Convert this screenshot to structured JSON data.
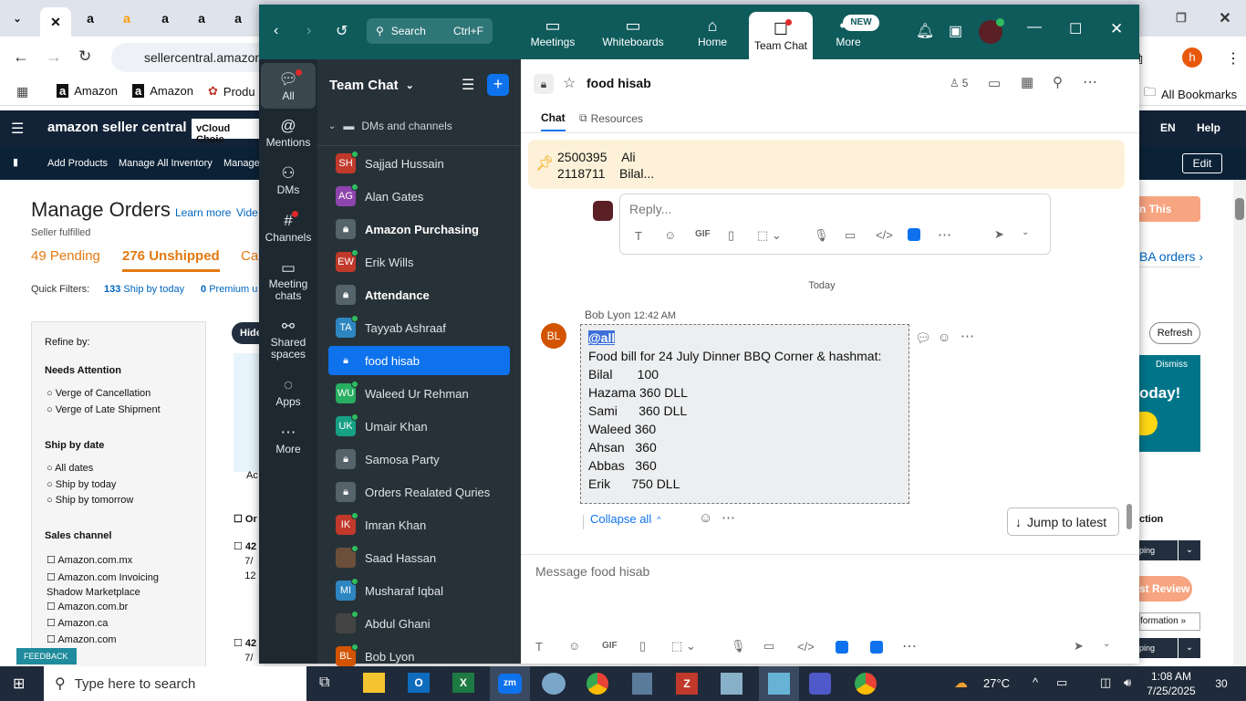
{
  "browser": {
    "url": "sellercentral.amazon",
    "bookmarks": [
      "Amazon",
      "Amazon",
      "Produ"
    ],
    "all_bookmarks": "All Bookmarks",
    "profile_initial": "h"
  },
  "amazon": {
    "logo": "amazon seller central",
    "vcloud": "vCloud Choic",
    "lang": "EN",
    "help": "Help",
    "nav": [
      "Add Products",
      "Manage All Inventory",
      "Manage"
    ],
    "edit": "Edit",
    "page_title": "Manage Orders",
    "learn_more": "Learn more",
    "video": "Vide",
    "seller_fulfilled": "Seller fulfilled",
    "pending": "49 Pending",
    "unshipped_count": "276",
    "unshipped_label": "Unshipped",
    "canceled_partial": "Ca",
    "quick_filters": "Quick Filters:",
    "qf_ship_today_count": "133",
    "qf_ship_today": "Ship by today",
    "qf_premium_count": "0",
    "qf_premium": "Premium u",
    "refine": "Refine by:",
    "needs_attention": "Needs Attention",
    "attention_opts": [
      "Verge of Cancellation",
      "Verge of Late Shipment"
    ],
    "ship_by_date": "Ship by date",
    "ship_opts": [
      "All dates",
      "Ship by today",
      "Ship by tomorrow"
    ],
    "sales_channel": "Sales channel",
    "channels": [
      "Amazon.com.mx",
      "Amazon.com Invoicing Shadow Marketplace",
      "Amazon.com.br",
      "Amazon.ca",
      "Amazon.com"
    ],
    "hide": "Hide",
    "ac": "Ac",
    "order_col": "Or",
    "row1": "42",
    "row1b": "7/",
    "row1c": "12",
    "row2": "42",
    "row2b": "7/",
    "help_page": "n This Page",
    "fba_orders": "BA orders",
    "refresh": "Refresh",
    "dismiss": "Dismiss",
    "today": "oday!",
    "action": "ction",
    "shipping1": "ping",
    "est_review": "st Review",
    "information": "formation",
    "shipping2": "ping",
    "feedback": "FEEDBACK"
  },
  "zoom": {
    "search_label": "Search",
    "search_shortcut": "Ctrl+F",
    "tabs": [
      {
        "label": "Meetings",
        "icon": "video-icon"
      },
      {
        "label": "Whiteboards",
        "icon": "whiteboard-icon"
      },
      {
        "label": "Home",
        "icon": "home-icon"
      },
      {
        "label": "Team Chat",
        "icon": "chat-icon"
      },
      {
        "label": "More",
        "icon": "more-icon",
        "badge": "NEW"
      }
    ],
    "rail": [
      {
        "label": "All",
        "icon": "chat-bubble-icon"
      },
      {
        "label": "Mentions",
        "icon": "at-icon"
      },
      {
        "label": "DMs",
        "icon": "people-icon"
      },
      {
        "label": "Channels",
        "icon": "hash-icon"
      },
      {
        "label": "Meeting chats",
        "icon": "calendar-icon"
      },
      {
        "label": "Shared spaces",
        "icon": "share-icon"
      },
      {
        "label": "Apps",
        "icon": "apps-icon"
      },
      {
        "label": "More",
        "icon": "ellipsis-icon"
      }
    ],
    "list_title": "Team Chat",
    "section": "DMs and channels",
    "chats": [
      {
        "name": "Sajjad Hussain",
        "initials": "SH",
        "color": "#c0392b",
        "bold": false,
        "lock": false
      },
      {
        "name": "Alan Gates",
        "initials": "AG",
        "color": "#8e44ad",
        "bold": false,
        "lock": false
      },
      {
        "name": "Amazon Purchasing",
        "initials": "",
        "color": "#55636b",
        "bold": true,
        "lock": true
      },
      {
        "name": "Erik Wills",
        "initials": "EW",
        "color": "#c0392b",
        "bold": false,
        "lock": false
      },
      {
        "name": "Attendance",
        "initials": "",
        "color": "#55636b",
        "bold": true,
        "lock": true
      },
      {
        "name": "Tayyab Ashraaf",
        "initials": "TA",
        "color": "#2e86c1",
        "bold": false,
        "lock": false
      },
      {
        "name": "food hisab",
        "initials": "",
        "color": "#0e72ed",
        "bold": false,
        "lock": true,
        "active": true
      },
      {
        "name": "Waleed Ur Rehman",
        "initials": "WU",
        "color": "#27ae60",
        "bold": false,
        "lock": false
      },
      {
        "name": "Umair Khan",
        "initials": "UK",
        "color": "#16a085",
        "bold": false,
        "lock": false
      },
      {
        "name": "Samosa Party",
        "initials": "",
        "color": "#55636b",
        "bold": false,
        "lock": true
      },
      {
        "name": "Orders Realated Quries",
        "initials": "",
        "color": "#55636b",
        "bold": false,
        "lock": true
      },
      {
        "name": "Imran Khan",
        "initials": "IK",
        "color": "#c0392b",
        "bold": false,
        "lock": false
      },
      {
        "name": "Saad Hassan",
        "initials": "",
        "color": "#6b4f3a",
        "bold": false,
        "lock": false
      },
      {
        "name": "Musharaf Iqbal",
        "initials": "MI",
        "color": "#2e86c1",
        "bold": false,
        "lock": false
      },
      {
        "name": "Abdul Ghani",
        "initials": "",
        "color": "#444",
        "bold": false,
        "lock": false
      },
      {
        "name": "Bob Lyon",
        "initials": "BL",
        "color": "#d35400",
        "bold": false,
        "lock": false
      }
    ],
    "channel_name": "food hisab",
    "members": "5",
    "tab_chat": "Chat",
    "tab_resources": "Resources",
    "pinned": [
      {
        "num": "2500395",
        "name": "Ali"
      },
      {
        "num": "2118711",
        "name": "Bilal..."
      }
    ],
    "reply_placeholder": "Reply...",
    "gif": "GIF",
    "divider": "Today",
    "sender": "Bob Lyon",
    "time": "12:42 AM",
    "avatar_initials": "BL",
    "mention": "@all",
    "message_lines": [
      "Food bill for 24 July Dinner BBQ Corner & hashmat:",
      "Bilal       100",
      "Hazama 360 DLL",
      "Sami      360 DLL",
      "Waleed 360",
      "Ahsan   360",
      "Abbas   360",
      "Erik      750 DLL"
    ],
    "collapse_all": "Collapse all",
    "jump_latest": "Jump to latest",
    "composer_placeholder": "Message food hisab"
  },
  "taskbar": {
    "search": "Type here to search",
    "temp": "27°C",
    "time": "1:08 AM",
    "date": "7/25/2025",
    "notif_count": "30"
  }
}
